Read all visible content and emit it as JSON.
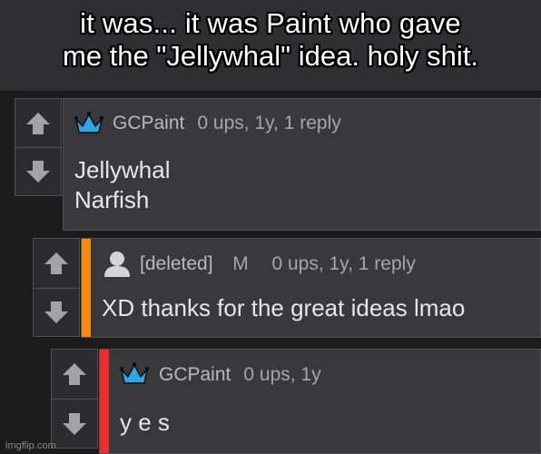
{
  "caption": {
    "line1": "it was... it was Paint who gave",
    "line2": "me the \"Jellywhal\" idea. holy shit."
  },
  "comments": [
    {
      "username": "GCPaint",
      "user_icon": "crown-icon",
      "user_flair": "",
      "stats": "0 ups, 1y, 1 reply",
      "body_lines": [
        "Jellywhal",
        "Narfish"
      ],
      "accent_color": null
    },
    {
      "username": "[deleted]",
      "user_icon": "user-avatar-icon",
      "user_flair": "M",
      "stats": "0 ups, 1y, 1 reply",
      "body_lines": [
        "XD thanks for the great ideas lmao"
      ],
      "accent_color": "#f58a11"
    },
    {
      "username": "GCPaint",
      "user_icon": "crown-icon",
      "user_flair": "",
      "stats": "0 ups, 1y",
      "body_lines": [
        "y e s"
      ],
      "accent_color": "#ee2e2e"
    }
  ],
  "colors": {
    "crown": "#2aa7e8",
    "arrow": "#a3a3a5"
  },
  "watermark": "imgflip.com"
}
